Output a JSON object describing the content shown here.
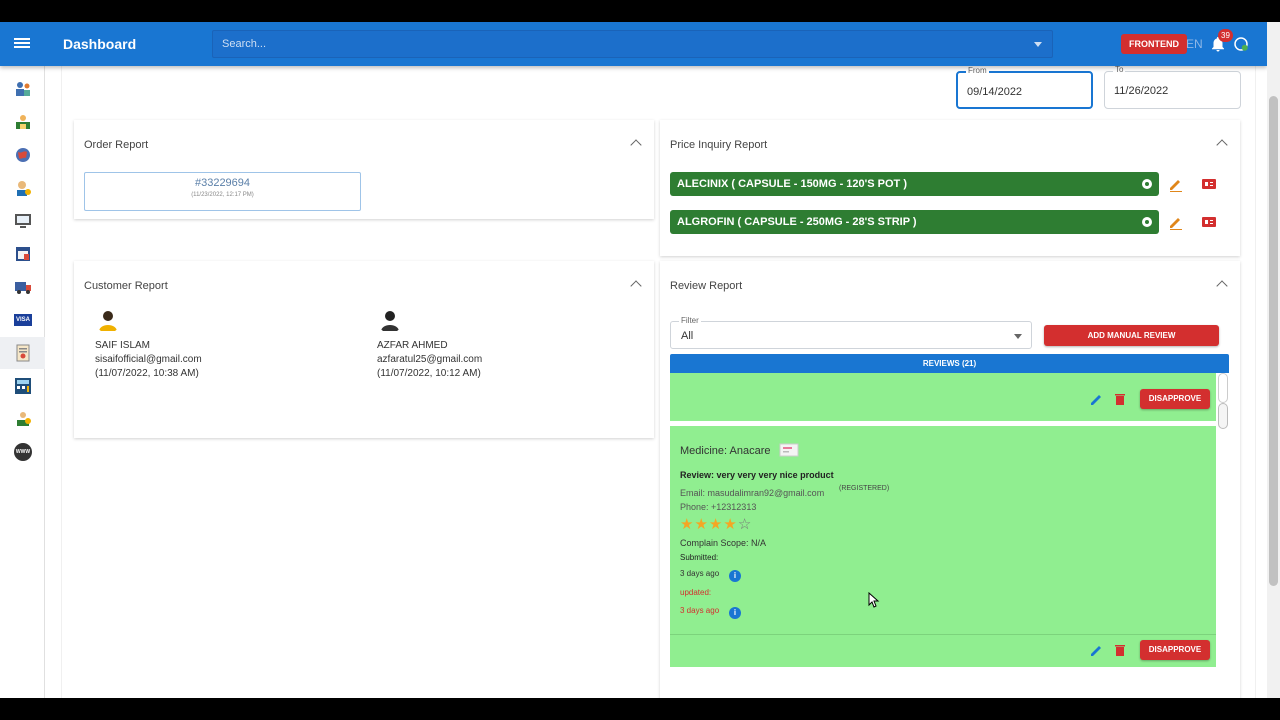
{
  "appbar": {
    "title": "Dashboard",
    "search_placeholder": "Search...",
    "frontend_label": "FRONTEND",
    "language": "EN",
    "notification_count": "39"
  },
  "sidebar": {
    "items": [
      "users-icon",
      "store-icon",
      "globe-icon",
      "person-icon",
      "monitor-icon",
      "calendar-icon",
      "delivery-icon",
      "visa-icon",
      "report-icon",
      "calculator-icon",
      "money-icon",
      "www-icon"
    ],
    "visa_text": "VISA",
    "www_text": "WWW",
    "active_index": 8
  },
  "date_range": {
    "from_label": "From",
    "from_value": "09/14/2022",
    "to_label": "To",
    "to_value": "11/26/2022"
  },
  "order_report": {
    "title": "Order Report",
    "orders": [
      {
        "id": "#33229694",
        "date": "(11/23/2022, 12:17 PM)"
      }
    ]
  },
  "price_inquiry": {
    "title": "Price Inquiry Report",
    "items": [
      {
        "label": "ALECINIX ( CAPSULE - 150MG - 120'S POT )"
      },
      {
        "label": "ALGROFIN ( CAPSULE - 250MG - 28'S STRIP )"
      }
    ]
  },
  "customer_report": {
    "title": "Customer Report",
    "customers": [
      {
        "name": "SAIF ISLAM",
        "email": "sisaifofficial@gmail.com",
        "date": "(11/07/2022, 10:38 AM)"
      },
      {
        "name": "AZFAR AHMED",
        "email": "azfaratul25@gmail.com",
        "date": "(11/07/2022, 10:12 AM)"
      }
    ]
  },
  "review_report": {
    "title": "Review Report",
    "filter_label": "Filter",
    "filter_value": "All",
    "add_button": "ADD MANUAL REVIEW",
    "reviews_header": "REVIEWS (21)",
    "disapprove_label": "DISAPPROVE",
    "review": {
      "medicine": "Medicine: Anacare",
      "text": "Review: very very very nice product",
      "email": "Email: masudalimran92@gmail.com",
      "registered": "(REGISTERED)",
      "phone": "Phone: +12312313",
      "rating": 4,
      "rating_max": 5,
      "complain_scope": "Complain Scope: N/A",
      "submitted_label": "Submitted:",
      "submitted_ago": "3 days ago",
      "updated_label": "updated:",
      "updated_ago": "3 days ago"
    }
  },
  "colors": {
    "primary": "#1976d2",
    "danger": "#d32f2f",
    "price_green": "#2e7d32",
    "review_green": "#90ee90",
    "edit_orange": "#e0861a"
  }
}
